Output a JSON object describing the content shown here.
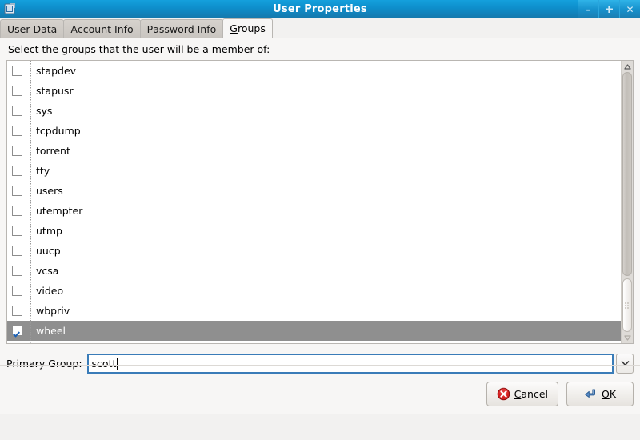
{
  "window": {
    "title": "User Properties",
    "icon": "user-properties-icon",
    "controls": [
      {
        "name": "minimize-button",
        "glyph": "–"
      },
      {
        "name": "maximize-button",
        "glyph": "✚"
      },
      {
        "name": "close-button",
        "glyph": "✕"
      }
    ]
  },
  "tabs": [
    {
      "label": "User Data",
      "accel": "U",
      "rest": "ser Data",
      "active": false
    },
    {
      "label": "Account Info",
      "accel": "A",
      "rest": "ccount Info",
      "active": false
    },
    {
      "label": "Password Info",
      "accel": "P",
      "rest": "assword Info",
      "active": false
    },
    {
      "label": "Groups",
      "accel": "G",
      "rest": "roups",
      "active": true
    }
  ],
  "groups_tab": {
    "prompt": "Select the groups that the user will be a member of:",
    "rows": [
      {
        "name": "stapdev",
        "checked": false,
        "selected": false
      },
      {
        "name": "stapusr",
        "checked": false,
        "selected": false
      },
      {
        "name": "sys",
        "checked": false,
        "selected": false
      },
      {
        "name": "tcpdump",
        "checked": false,
        "selected": false
      },
      {
        "name": "torrent",
        "checked": false,
        "selected": false
      },
      {
        "name": "tty",
        "checked": false,
        "selected": false
      },
      {
        "name": "users",
        "checked": false,
        "selected": false
      },
      {
        "name": "utempter",
        "checked": false,
        "selected": false
      },
      {
        "name": "utmp",
        "checked": false,
        "selected": false
      },
      {
        "name": "uucp",
        "checked": false,
        "selected": false
      },
      {
        "name": "vcsa",
        "checked": false,
        "selected": false
      },
      {
        "name": "video",
        "checked": false,
        "selected": false
      },
      {
        "name": "wbpriv",
        "checked": false,
        "selected": false
      },
      {
        "name": "wheel",
        "checked": true,
        "selected": true
      }
    ],
    "scrollbar": {
      "up_arrow_glyph": "▲",
      "down_arrow_glyph": "▼"
    },
    "primary_group": {
      "label": "Primary Group:",
      "value": "scott",
      "dropdown_glyph": "∨"
    }
  },
  "actions": [
    {
      "name": "cancel-button",
      "icon": "cancel-icon",
      "accel": "C",
      "rest": "ancel"
    },
    {
      "name": "ok-button",
      "icon": "enter-key-icon",
      "accel": "O",
      "rest": "K"
    }
  ],
  "colors": {
    "titlebar_top": "#14a0dd",
    "titlebar_bottom": "#1579ad",
    "selection": "#8f8f8f",
    "check": "#1a5fb4",
    "focus_border": "#3a7cb8",
    "cancel_red": "#cc0000"
  }
}
